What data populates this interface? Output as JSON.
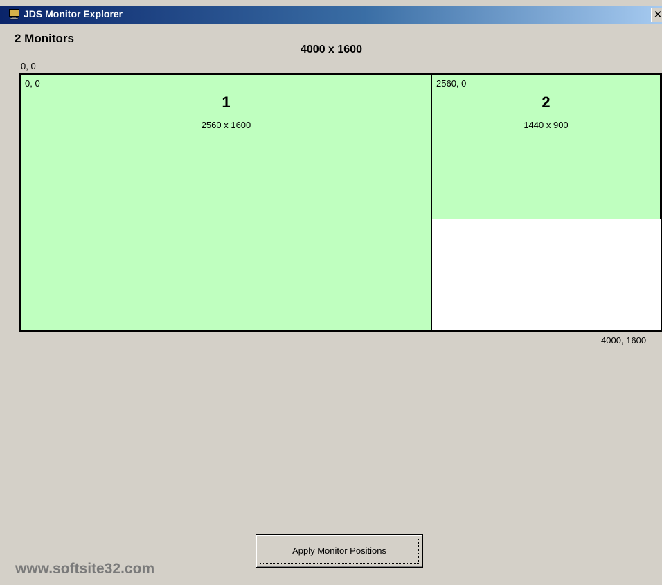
{
  "window": {
    "title": "JDS Monitor Explorer",
    "close_glyph": "✕"
  },
  "summary": {
    "monitor_count": "2 Monitors",
    "total_resolution": "4000 x 1600",
    "origin": "0, 0",
    "end_coord": "4000, 1600"
  },
  "monitors": [
    {
      "number": "1",
      "position": "0, 0",
      "resolution": "2560 x 1600",
      "color": "#bfffbf"
    },
    {
      "number": "2",
      "position": "2560, 0",
      "resolution": "1440 x 900",
      "color": "#bfffbf"
    }
  ],
  "actions": {
    "apply_label": "Apply Monitor Positions"
  },
  "watermark": "www.softsite32.com",
  "colors": {
    "monitor_fill": "#bfffbf",
    "desktop_background": "#ffffff",
    "dialog_background": "#d4d0c8",
    "titlebar_start": "#0a246a"
  },
  "icons": {
    "title_icon": "monitor-icon",
    "close_icon": "close-icon"
  }
}
